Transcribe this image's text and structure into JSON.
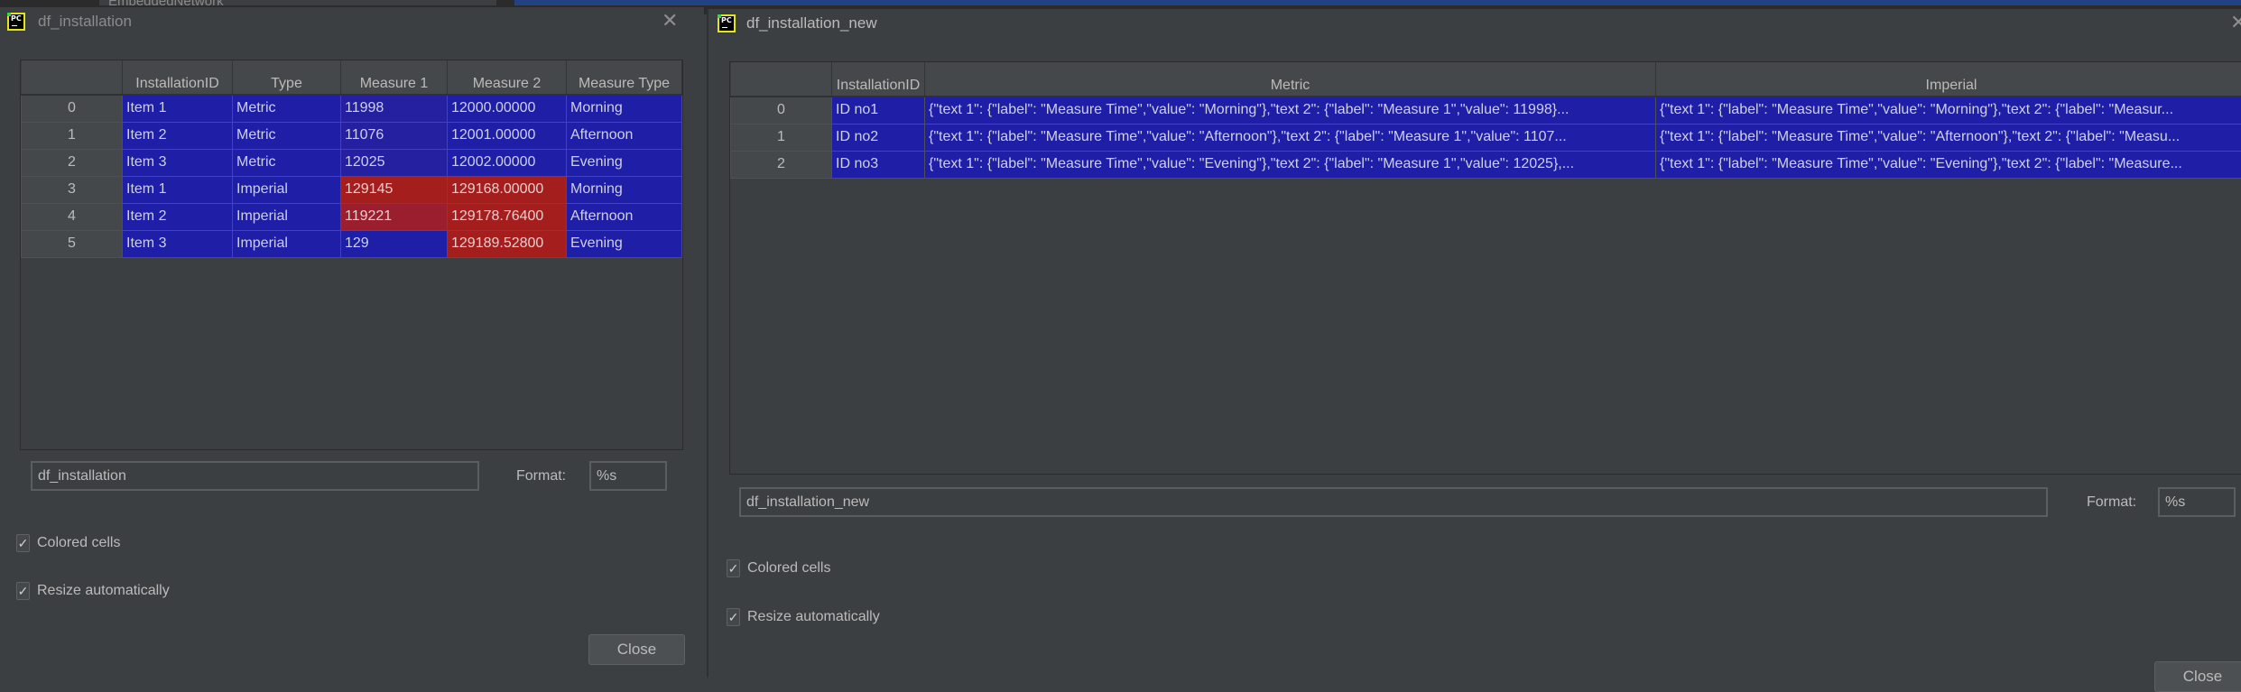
{
  "background": {
    "partial_text": "EmbeddedNetwork"
  },
  "windows": [
    {
      "title": "df_installation",
      "app_icon": "pycharm-icon",
      "close_icon": "close-icon",
      "table": {
        "columns": [
          "",
          "InstallationID",
          "Type",
          "Measure 1",
          "Measure 2",
          "Measure Type"
        ],
        "rows": [
          {
            "index": "0",
            "cells": [
              "Item 1",
              "Metric",
              "11998",
              "12000.00000",
              "Morning"
            ]
          },
          {
            "index": "1",
            "cells": [
              "Item 2",
              "Metric",
              "11076",
              "12001.00000",
              "Afternoon"
            ]
          },
          {
            "index": "2",
            "cells": [
              "Item 3",
              "Metric",
              "12025",
              "12002.00000",
              "Evening"
            ]
          },
          {
            "index": "3",
            "cells": [
              "Item 1",
              "Imperial",
              "129145",
              "129168.00000",
              "Morning"
            ]
          },
          {
            "index": "4",
            "cells": [
              "Item 2",
              "Imperial",
              "119221",
              "129178.76400",
              "Afternoon"
            ]
          },
          {
            "index": "5",
            "cells": [
              "Item 3",
              "Imperial",
              "129",
              "129189.52800",
              "Evening"
            ]
          }
        ]
      },
      "name_field": "df_installation",
      "format_label": "Format:",
      "format_value": "%s",
      "colored_cells": {
        "label": "Colored cells",
        "checked": true
      },
      "resize_auto": {
        "label": "Resize automatically",
        "checked": true
      },
      "close_label": "Close"
    },
    {
      "title": "df_installation_new",
      "app_icon": "pycharm-icon",
      "close_icon": "close-icon",
      "table": {
        "columns": [
          "",
          "InstallationID",
          "Metric",
          "Imperial"
        ],
        "rows": [
          {
            "index": "0",
            "cells": [
              "ID no1",
              "{\"text 1\": {\"label\": \"Measure Time\",\"value\": \"Morning\"},\"text 2\": {\"label\": \"Measure 1\",\"value\": 11998}...",
              "{\"text 1\": {\"label\": \"Measure Time\",\"value\": \"Morning\"},\"text 2\": {\"label\": \"Measur..."
            ]
          },
          {
            "index": "1",
            "cells": [
              "ID no2",
              "{\"text 1\": {\"label\": \"Measure Time\",\"value\": \"Afternoon\"},\"text 2\": {\"label\": \"Measure 1\",\"value\": 1107...",
              "{\"text 1\": {\"label\": \"Measure Time\",\"value\": \"Afternoon\"},\"text 2\": {\"label\": \"Measu..."
            ]
          },
          {
            "index": "2",
            "cells": [
              "ID no3",
              "{\"text 1\": {\"label\": \"Measure Time\",\"value\": \"Evening\"},\"text 2\": {\"label\": \"Measure 1\",\"value\": 12025},...",
              "{\"text 1\": {\"label\": \"Measure Time\",\"value\": \"Evening\"},\"text 2\": {\"label\": \"Measure..."
            ]
          }
        ]
      },
      "name_field": "df_installation_new",
      "format_label": "Format:",
      "format_value": "%s",
      "colored_cells": {
        "label": "Colored cells",
        "checked": true
      },
      "resize_auto": {
        "label": "Resize automatically",
        "checked": true
      },
      "close_label": "Close"
    }
  ],
  "colors": {
    "cell_blue": "#1e1ea6",
    "cell_red": "#a51e1e",
    "window_bg": "#3c3f41",
    "header_bg": "#45484a"
  },
  "checkmark": "✓",
  "close_glyph": "✕"
}
